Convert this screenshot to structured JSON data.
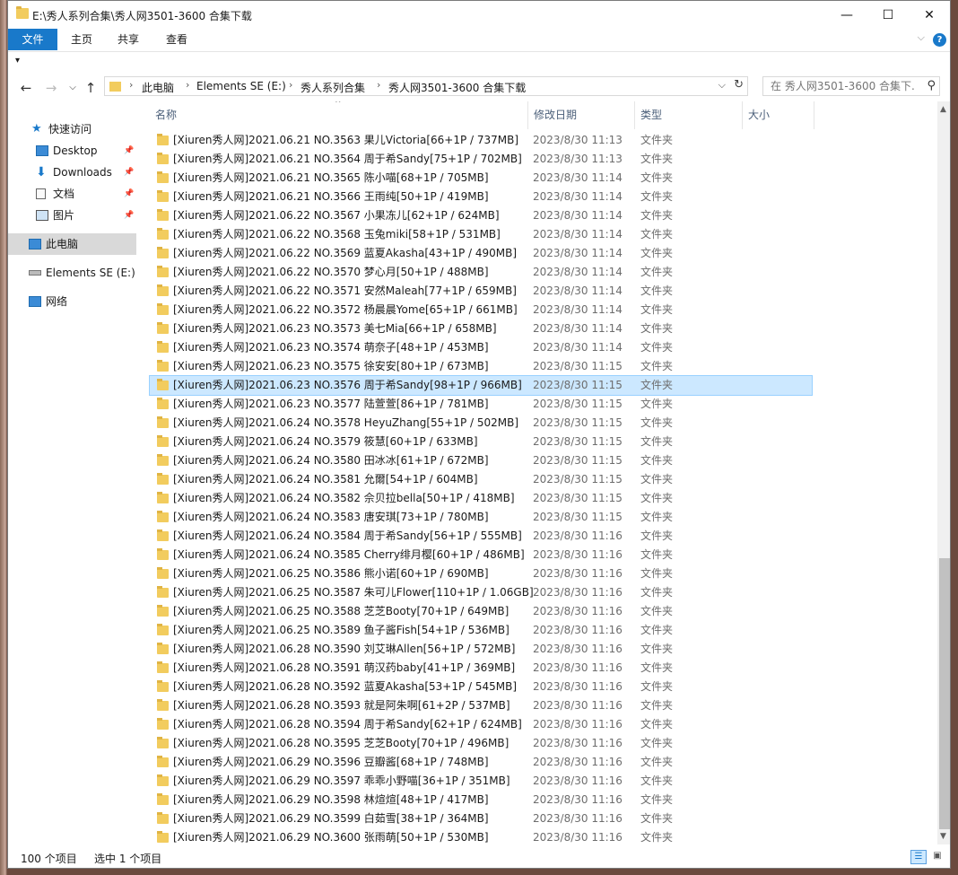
{
  "window": {
    "title": "E:\\秀人系列合集\\秀人网3501-3600 合集下载",
    "controls": {
      "minimize": "—",
      "maximize": "☐",
      "close": "✕"
    }
  },
  "ribbon": {
    "tabs": [
      "文件",
      "主页",
      "共享",
      "查看"
    ],
    "help": "?"
  },
  "address": {
    "crumbs": [
      "此电脑",
      "Elements SE (E:)",
      "秀人系列合集",
      "秀人网3501-3600 合集下载"
    ],
    "search_placeholder": "在 秀人网3501-3600 合集下..."
  },
  "nav": {
    "items": [
      {
        "label": "快速访问",
        "icon": "star-icon"
      },
      {
        "label": "Desktop",
        "icon": "desktop-icon",
        "pinned": true
      },
      {
        "label": "Downloads",
        "icon": "download-icon",
        "pinned": true
      },
      {
        "label": "文档",
        "icon": "document-icon",
        "pinned": true
      },
      {
        "label": "图片",
        "icon": "picture-icon",
        "pinned": true
      },
      {
        "label": "此电脑",
        "icon": "computer-icon",
        "selected": true
      },
      {
        "label": "Elements SE (E:)",
        "icon": "drive-icon"
      },
      {
        "label": "网络",
        "icon": "network-icon"
      }
    ]
  },
  "columns": {
    "name": "名称",
    "date": "修改日期",
    "type": "类型",
    "size": "大小"
  },
  "files": [
    {
      "name": "[Xiuren秀人网]2021.06.21 NO.3563 果儿Victoria[66+1P / 737MB]",
      "date": "2023/8/30 11:13",
      "type": "文件夹"
    },
    {
      "name": "[Xiuren秀人网]2021.06.21 NO.3564 周于希Sandy[75+1P / 702MB]",
      "date": "2023/8/30 11:13",
      "type": "文件夹"
    },
    {
      "name": "[Xiuren秀人网]2021.06.21 NO.3565 陈小喵[68+1P / 705MB]",
      "date": "2023/8/30 11:14",
      "type": "文件夹"
    },
    {
      "name": "[Xiuren秀人网]2021.06.21 NO.3566 王雨纯[50+1P / 419MB]",
      "date": "2023/8/30 11:14",
      "type": "文件夹"
    },
    {
      "name": "[Xiuren秀人网]2021.06.22 NO.3567 小果冻儿[62+1P / 624MB]",
      "date": "2023/8/30 11:14",
      "type": "文件夹"
    },
    {
      "name": "[Xiuren秀人网]2021.06.22 NO.3568 玉兔miki[58+1P / 531MB]",
      "date": "2023/8/30 11:14",
      "type": "文件夹"
    },
    {
      "name": "[Xiuren秀人网]2021.06.22 NO.3569 蓝夏Akasha[43+1P / 490MB]",
      "date": "2023/8/30 11:14",
      "type": "文件夹"
    },
    {
      "name": "[Xiuren秀人网]2021.06.22 NO.3570 梦心月[50+1P / 488MB]",
      "date": "2023/8/30 11:14",
      "type": "文件夹"
    },
    {
      "name": "[Xiuren秀人网]2021.06.22 NO.3571 安然Maleah[77+1P / 659MB]",
      "date": "2023/8/30 11:14",
      "type": "文件夹"
    },
    {
      "name": "[Xiuren秀人网]2021.06.22 NO.3572 杨晨晨Yome[65+1P / 661MB]",
      "date": "2023/8/30 11:14",
      "type": "文件夹"
    },
    {
      "name": "[Xiuren秀人网]2021.06.23 NO.3573 美七Mia[66+1P / 658MB]",
      "date": "2023/8/30 11:14",
      "type": "文件夹"
    },
    {
      "name": "[Xiuren秀人网]2021.06.23 NO.3574 萌奈子[48+1P / 453MB]",
      "date": "2023/8/30 11:14",
      "type": "文件夹"
    },
    {
      "name": "[Xiuren秀人网]2021.06.23 NO.3575 徐安安[80+1P / 673MB]",
      "date": "2023/8/30 11:15",
      "type": "文件夹"
    },
    {
      "name": "[Xiuren秀人网]2021.06.23 NO.3576 周于希Sandy[98+1P / 966MB]",
      "date": "2023/8/30 11:15",
      "type": "文件夹",
      "selected": true
    },
    {
      "name": "[Xiuren秀人网]2021.06.23 NO.3577 陆萱萱[86+1P / 781MB]",
      "date": "2023/8/30 11:15",
      "type": "文件夹"
    },
    {
      "name": "[Xiuren秀人网]2021.06.24 NO.3578 HeyuZhang[55+1P / 502MB]",
      "date": "2023/8/30 11:15",
      "type": "文件夹"
    },
    {
      "name": "[Xiuren秀人网]2021.06.24 NO.3579 筱慧[60+1P / 633MB]",
      "date": "2023/8/30 11:15",
      "type": "文件夹"
    },
    {
      "name": "[Xiuren秀人网]2021.06.24 NO.3580 田冰冰[61+1P / 672MB]",
      "date": "2023/8/30 11:15",
      "type": "文件夹"
    },
    {
      "name": "[Xiuren秀人网]2021.06.24 NO.3581 允爾[54+1P / 604MB]",
      "date": "2023/8/30 11:15",
      "type": "文件夹"
    },
    {
      "name": "[Xiuren秀人网]2021.06.24 NO.3582 佘贝拉bella[50+1P / 418MB]",
      "date": "2023/8/30 11:15",
      "type": "文件夹"
    },
    {
      "name": "[Xiuren秀人网]2021.06.24 NO.3583 唐安琪[73+1P / 780MB]",
      "date": "2023/8/30 11:15",
      "type": "文件夹"
    },
    {
      "name": "[Xiuren秀人网]2021.06.24 NO.3584 周于希Sandy[56+1P / 555MB]",
      "date": "2023/8/30 11:16",
      "type": "文件夹"
    },
    {
      "name": "[Xiuren秀人网]2021.06.24 NO.3585 Cherry绯月樱[60+1P / 486MB]",
      "date": "2023/8/30 11:16",
      "type": "文件夹"
    },
    {
      "name": "[Xiuren秀人网]2021.06.25 NO.3586 熊小诺[60+1P / 690MB]",
      "date": "2023/8/30 11:16",
      "type": "文件夹"
    },
    {
      "name": "[Xiuren秀人网]2021.06.25 NO.3587 朱可儿Flower[110+1P / 1.06GB]",
      "date": "2023/8/30 11:16",
      "type": "文件夹"
    },
    {
      "name": "[Xiuren秀人网]2021.06.25 NO.3588 芝芝Booty[70+1P / 649MB]",
      "date": "2023/8/30 11:16",
      "type": "文件夹"
    },
    {
      "name": "[Xiuren秀人网]2021.06.25 NO.3589 鱼子酱Fish[54+1P / 536MB]",
      "date": "2023/8/30 11:16",
      "type": "文件夹"
    },
    {
      "name": "[Xiuren秀人网]2021.06.28 NO.3590 刘艾琳Allen[56+1P / 572MB]",
      "date": "2023/8/30 11:16",
      "type": "文件夹"
    },
    {
      "name": "[Xiuren秀人网]2021.06.28 NO.3591 萌汉药baby[41+1P / 369MB]",
      "date": "2023/8/30 11:16",
      "type": "文件夹"
    },
    {
      "name": "[Xiuren秀人网]2021.06.28 NO.3592 蓝夏Akasha[53+1P / 545MB]",
      "date": "2023/8/30 11:16",
      "type": "文件夹"
    },
    {
      "name": "[Xiuren秀人网]2021.06.28 NO.3593 就是阿朱啊[61+2P / 537MB]",
      "date": "2023/8/30 11:16",
      "type": "文件夹"
    },
    {
      "name": "[Xiuren秀人网]2021.06.28 NO.3594 周于希Sandy[62+1P / 624MB]",
      "date": "2023/8/30 11:16",
      "type": "文件夹"
    },
    {
      "name": "[Xiuren秀人网]2021.06.28 NO.3595 芝芝Booty[70+1P / 496MB]",
      "date": "2023/8/30 11:16",
      "type": "文件夹"
    },
    {
      "name": "[Xiuren秀人网]2021.06.29 NO.3596 豆瓣酱[68+1P / 748MB]",
      "date": "2023/8/30 11:16",
      "type": "文件夹"
    },
    {
      "name": "[Xiuren秀人网]2021.06.29 NO.3597 乖乖小野喵[36+1P / 351MB]",
      "date": "2023/8/30 11:16",
      "type": "文件夹"
    },
    {
      "name": "[Xiuren秀人网]2021.06.29 NO.3598 林煊煊[48+1P / 417MB]",
      "date": "2023/8/30 11:16",
      "type": "文件夹"
    },
    {
      "name": "[Xiuren秀人网]2021.06.29 NO.3599 白茹雪[38+1P / 364MB]",
      "date": "2023/8/30 11:16",
      "type": "文件夹"
    },
    {
      "name": "[Xiuren秀人网]2021.06.29 NO.3600 张雨萌[50+1P / 530MB]",
      "date": "2023/8/30 11:16",
      "type": "文件夹"
    }
  ],
  "scroll": {
    "position": 1.0,
    "visible_fraction": 0.38
  },
  "status": {
    "count": "100 个项目",
    "selected": "选中 1 个项目"
  }
}
